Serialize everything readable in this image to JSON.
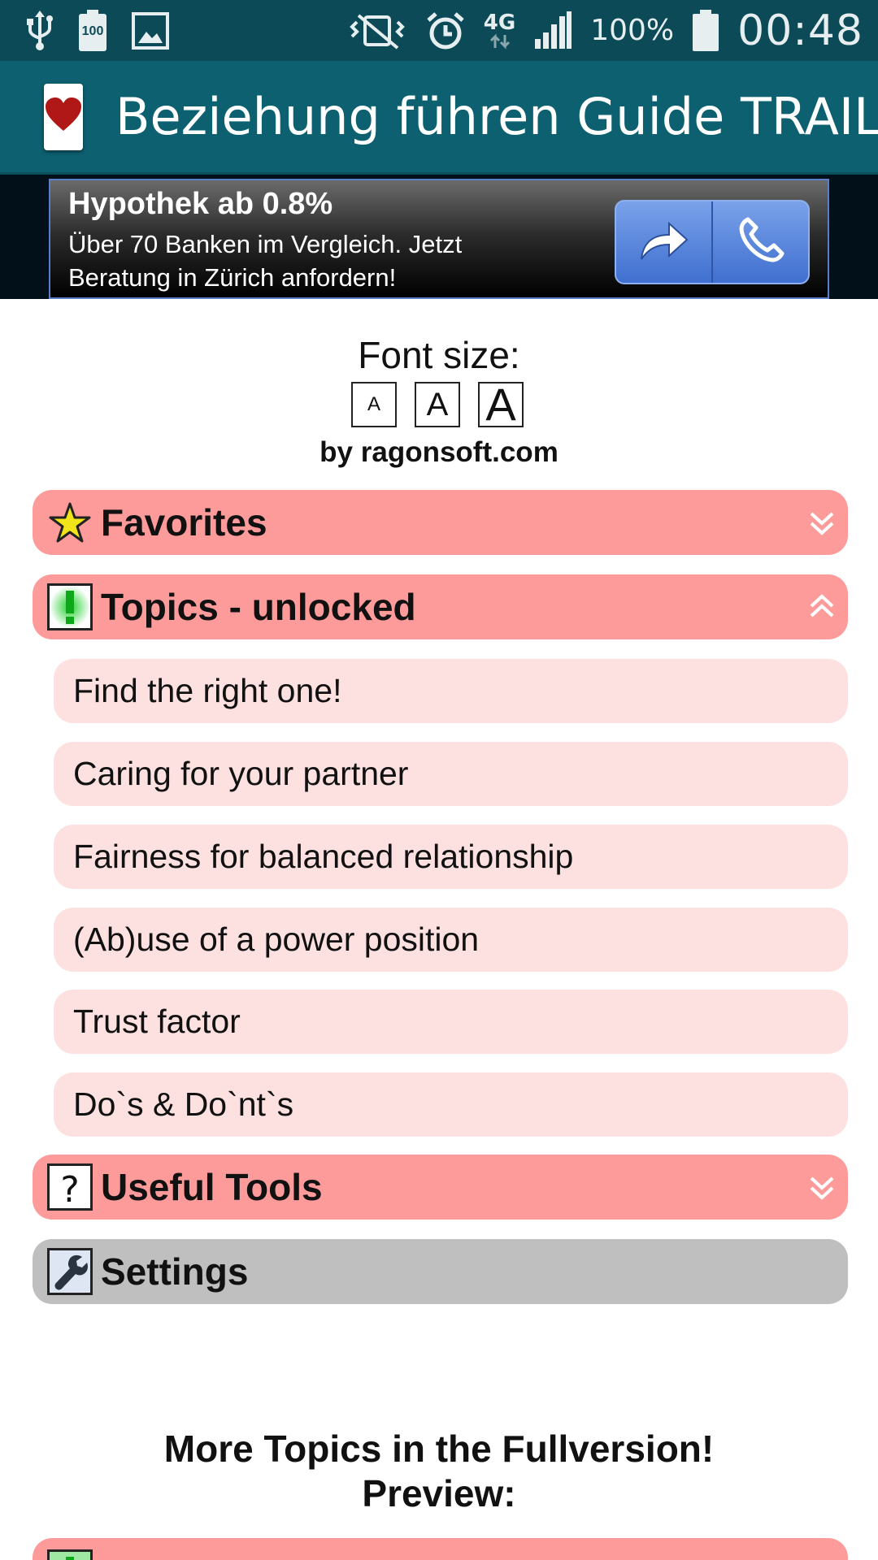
{
  "status_bar": {
    "battery_level_icon_text": "100",
    "network_type": "4G",
    "battery_percent": "100%",
    "time": "00:48"
  },
  "app_bar": {
    "title": "Beziehung führen Guide TRAIL"
  },
  "ad": {
    "title": "Hypothek ab 0.8%",
    "body": "Über 70 Banken im Vergleich. Jetzt Beratung in Zürich anfordern!"
  },
  "font_size": {
    "label": "Font size:",
    "options": [
      "A",
      "A",
      "A"
    ]
  },
  "byline": "by ragonsoft.com",
  "sections": [
    {
      "label": "Favorites",
      "expanded": false
    },
    {
      "label": "Topics - unlocked",
      "expanded": true
    },
    {
      "label": "Useful Tools",
      "expanded": false
    },
    {
      "label": "Settings"
    }
  ],
  "topics": [
    "Find the right one!",
    "Caring for your partner",
    "Fairness for balanced relationship",
    "(Ab)use of a power position",
    "Trust factor",
    "Do`s & Do`nt`s"
  ],
  "more_topics": {
    "line1": "More Topics in the Fullversion!",
    "line2": "Preview:"
  },
  "colors": {
    "status_bar": "#0d4a58",
    "app_bar": "#0d6070",
    "section_pink": "#fd9b9b",
    "item_pink": "#fde0e0",
    "settings_gray": "#bfbfbf"
  }
}
